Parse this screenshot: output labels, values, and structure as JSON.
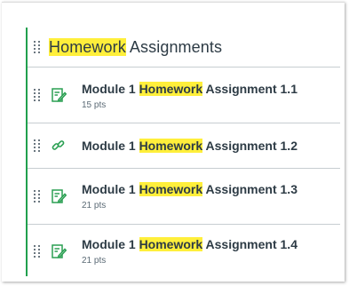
{
  "module": {
    "title_highlight": "Homework",
    "title_rest": " Assignments"
  },
  "items": [
    {
      "prefix": "Module 1 ",
      "highlight": "Homework",
      "rest": " Assignment 1.1",
      "points": "15 pts",
      "type": "assignment-icon"
    },
    {
      "prefix": "Module 1 ",
      "highlight": "Homework",
      "rest": " Assignment 1.2",
      "points": "",
      "type": "link-icon"
    },
    {
      "prefix": "Module 1 ",
      "highlight": "Homework",
      "rest": " Assignment 1.3",
      "points": "21 pts",
      "type": "assignment-icon"
    },
    {
      "prefix": "Module 1 ",
      "highlight": "Homework",
      "rest": " Assignment 1.4",
      "points": "21 pts",
      "type": "assignment-icon"
    }
  ],
  "colors": {
    "highlight": "#ffef3b",
    "module_bar": "#21a04e",
    "icon_green": "#2a9f52",
    "text": "#2d3b45"
  }
}
